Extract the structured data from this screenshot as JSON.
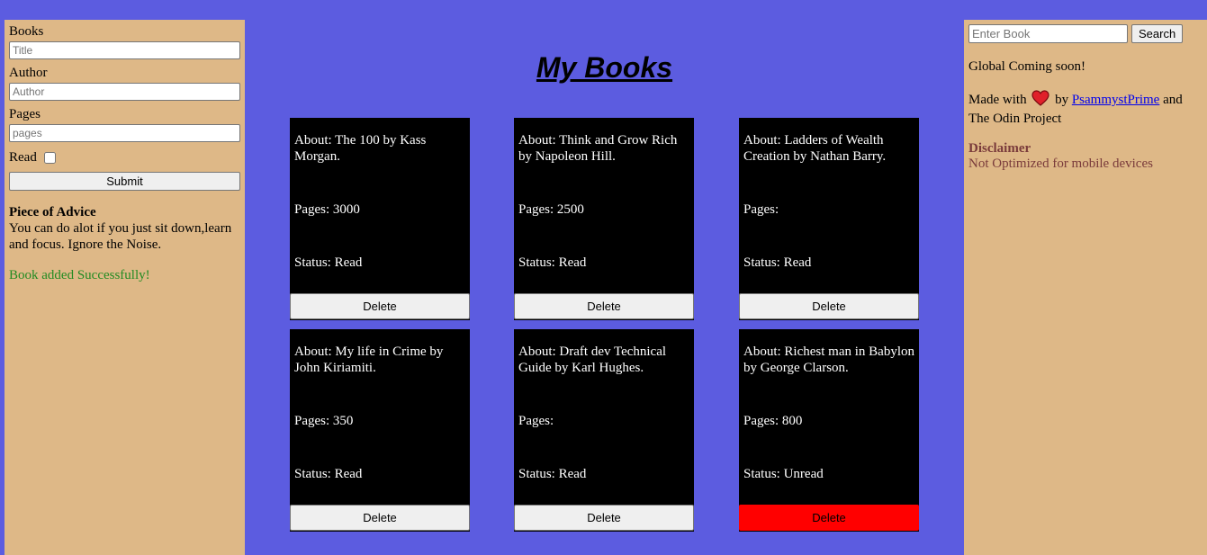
{
  "form": {
    "books_label": "Books",
    "title_placeholder": "Title",
    "author_label": "Author",
    "author_placeholder": "Author",
    "pages_label": "Pages",
    "pages_placeholder": "pages",
    "read_label": "Read",
    "read_checked": false,
    "submit_label": "Submit"
  },
  "advice": {
    "title": "Piece of Advice",
    "text": "You can do alot if you just sit down,learn and focus. Ignore the Noise."
  },
  "success_message": "Book added Successfully!",
  "page_title": "My Books",
  "books": [
    {
      "about": "About: The 100 by Kass Morgan.",
      "pages": "Pages: 3000",
      "status": "Status: Read",
      "delete_label": "Delete"
    },
    {
      "about": "About: Think and Grow Rich by Napoleon Hill.",
      "pages": "Pages: 2500",
      "status": "Status: Read",
      "delete_label": "Delete"
    },
    {
      "about": "About: Ladders of Wealth Creation by Nathan Barry.",
      "pages": "Pages:",
      "status": "Status: Read",
      "delete_label": "Delete"
    },
    {
      "about": "About: My life in Crime by John Kiriamiti.",
      "pages": "Pages: 350",
      "status": "Status: Read",
      "delete_label": "Delete"
    },
    {
      "about": "About: Draft dev Technical Guide by Karl Hughes.",
      "pages": "Pages:",
      "status": "Status: Read",
      "delete_label": "Delete"
    },
    {
      "about": "About: Richest man in Babylon by George Clarson.",
      "pages": "Pages: 800",
      "status": "Status: Unread",
      "delete_label": "Delete"
    }
  ],
  "search": {
    "placeholder": "Enter Book",
    "button_label": "Search"
  },
  "sidebar": {
    "global_text": "Global Coming soon!",
    "made_with": "Made with",
    "by": "by",
    "author_link": "PsammystPrime",
    "and_text": "and The Odin Project",
    "heart_icon": "heart-icon",
    "disclaimer_title": "Disclaimer",
    "disclaimer_text": "Not Optimized for mobile devices"
  },
  "colors": {
    "background": "#5c5ce0",
    "panel": "#deb887",
    "card": "#000000",
    "success": "#228b22",
    "delete_active": "#ff0000",
    "disclaimer": "#7a3b3b"
  }
}
